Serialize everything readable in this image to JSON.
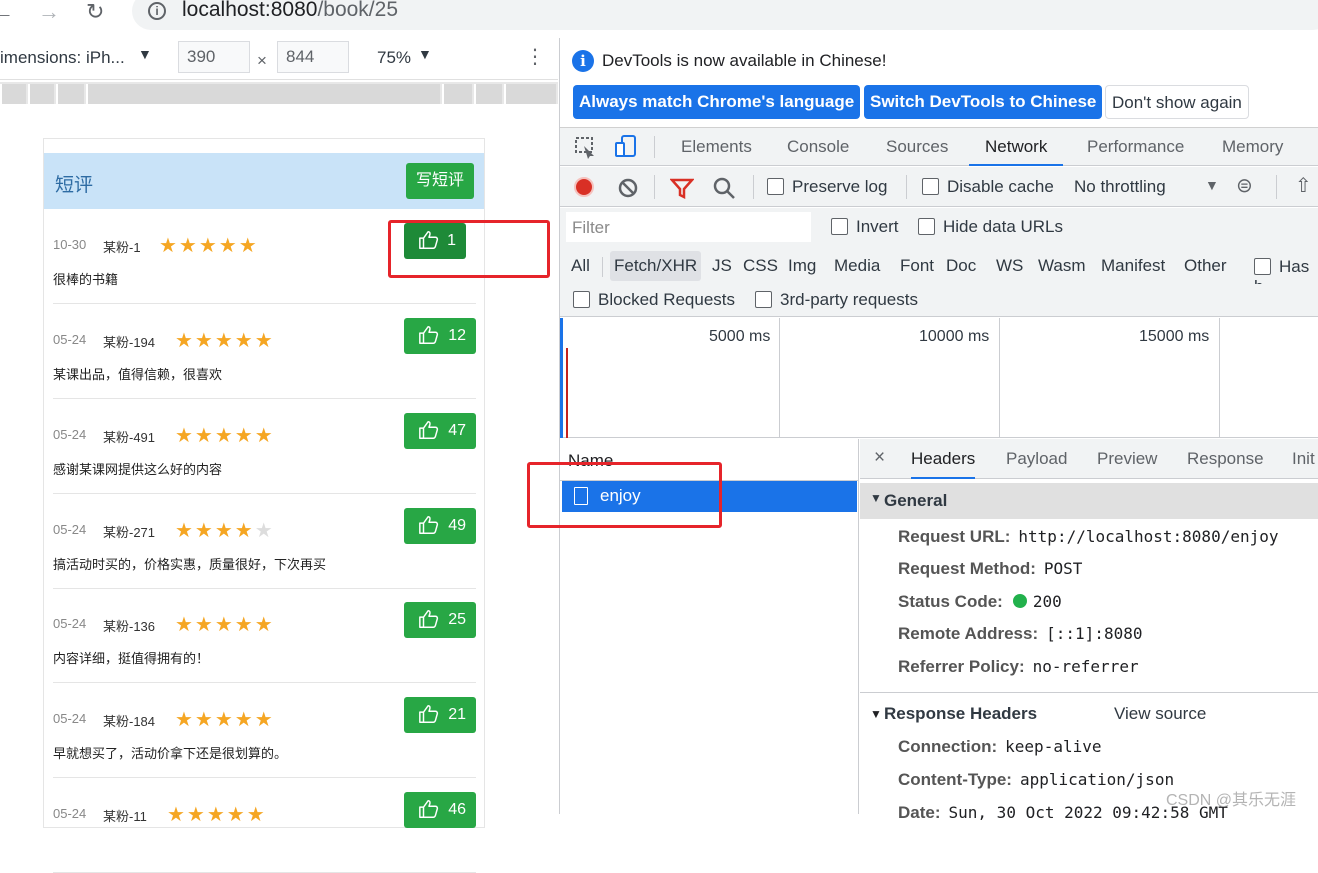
{
  "browser": {
    "url_host": "localhost:8080",
    "url_path": "/book/25",
    "back_icon": "back-arrow-icon",
    "forward_icon": "forward-arrow-icon",
    "reload_icon": "reload-icon"
  },
  "device_toolbar": {
    "dimensions": "imensions: iPh...",
    "width": "390",
    "times": "×",
    "height": "844",
    "zoom": "75%"
  },
  "page": {
    "header_title": "短评",
    "write_button": "写短评",
    "reviews": [
      {
        "date": "10-30",
        "user": "某粉-1",
        "stars": 5,
        "text": "很棒的书籍",
        "likes": "1"
      },
      {
        "date": "05-24",
        "user": "某粉-194",
        "stars": 5,
        "text": "某课出品，值得信赖，很喜欢",
        "likes": "12"
      },
      {
        "date": "05-24",
        "user": "某粉-491",
        "stars": 5,
        "text": "感谢某课网提供这么好的内容",
        "likes": "47"
      },
      {
        "date": "05-24",
        "user": "某粉-271",
        "stars": 4,
        "text": "搞活动时买的，价格实惠，质量很好，下次再买",
        "likes": "49"
      },
      {
        "date": "05-24",
        "user": "某粉-136",
        "stars": 5,
        "text": "内容详细，挺值得拥有的！",
        "likes": "25"
      },
      {
        "date": "05-24",
        "user": "某粉-184",
        "stars": 5,
        "text": "早就想买了，活动价拿下还是很划算的。",
        "likes": "21"
      },
      {
        "date": "05-24",
        "user": "某粉-11",
        "stars": 5,
        "text": "",
        "likes": "46"
      }
    ]
  },
  "devtools": {
    "info_message": "DevTools is now available in Chinese!",
    "btn_match": "Always match Chrome's language",
    "btn_switch": "Switch DevTools to Chinese",
    "btn_dismiss": "Don't show again",
    "tabs": [
      "Elements",
      "Console",
      "Sources",
      "Network",
      "Performance",
      "Memory"
    ],
    "active_tab": "Network",
    "preserve_log": "Preserve log",
    "disable_cache": "Disable cache",
    "throttling": "No throttling",
    "filter_placeholder": "Filter",
    "invert": "Invert",
    "hide_data_urls": "Hide data URLs",
    "types": [
      "All",
      "Fetch/XHR",
      "JS",
      "CSS",
      "Img",
      "Media",
      "Font",
      "Doc",
      "WS",
      "Wasm",
      "Manifest",
      "Other"
    ],
    "has_blocked": "Has b",
    "blocked_requests": "Blocked Requests",
    "third_party": "3rd-party requests",
    "timeline_labels": [
      "5000 ms",
      "10000 ms",
      "15000 ms"
    ],
    "name_header": "Name",
    "request_name": "enjoy",
    "detail_tabs": [
      "Headers",
      "Payload",
      "Preview",
      "Response",
      "Init"
    ],
    "general_title": "General",
    "general": [
      {
        "k": "Request URL:",
        "v": "http://localhost:8080/enjoy"
      },
      {
        "k": "Request Method:",
        "v": "POST"
      },
      {
        "k": "Status Code:",
        "v": "200"
      },
      {
        "k": "Remote Address:",
        "v": "[::1]:8080"
      },
      {
        "k": "Referrer Policy:",
        "v": "no-referrer"
      }
    ],
    "response_headers_title": "Response Headers",
    "view_source": "View source",
    "response_headers": [
      {
        "k": "Connection:",
        "v": "keep-alive"
      },
      {
        "k": "Content-Type:",
        "v": "application/json"
      },
      {
        "k": "Date:",
        "v": "Sun, 30 Oct 2022 09:42:58 GMT"
      }
    ],
    "status_color": "#22b14c"
  },
  "watermark": "CSDN @其乐无涯",
  "colors": {
    "accent": "#1a73e8",
    "like_green": "#28a745",
    "annotation_red": "#e6242a"
  }
}
